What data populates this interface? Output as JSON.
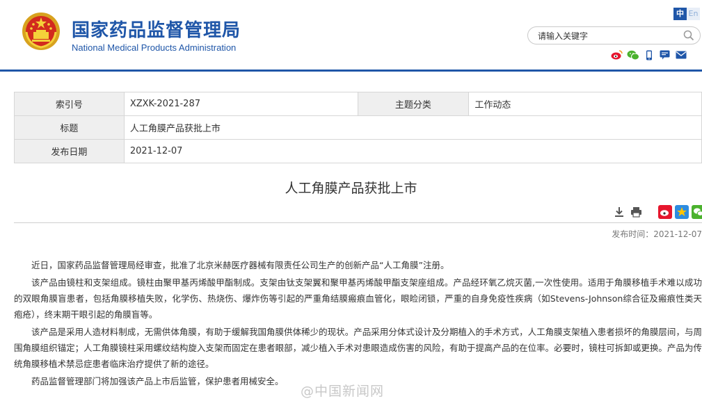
{
  "header": {
    "title_cn": "国家药品监督管理局",
    "title_en": "National Medical Products Administration",
    "lang_cn": "中",
    "lang_en": "En",
    "search_placeholder": "请输入关键字",
    "share_icons": [
      "weibo-icon",
      "wechat-icon",
      "mobile-icon",
      "message-icon",
      "email-icon"
    ]
  },
  "info": {
    "index_label": "索引号",
    "index_value": "XZXK-2021-287",
    "category_label": "主题分类",
    "category_value": "工作动态",
    "title_label": "标题",
    "title_value": "人工角膜产品获批上市",
    "date_label": "发布日期",
    "date_value": "2021-12-07"
  },
  "article": {
    "title": "人工角膜产品获批上市",
    "pubdate": "发布时间：2021-12-07",
    "paragraphs": [
      "近日，国家药品监督管理局经审查，批准了北京米赫医疗器械有限责任公司生产的创新产品“人工角膜”注册。",
      "该产品由镜柱和支架组成。镜柱由聚甲基丙烯酸甲酯制成。支架由钛支架翼和聚甲基丙烯酸甲酯支架座组成。产品经环氧乙烷灭菌,一次性使用。适用于角膜移植手术难以成功的双眼角膜盲患者，包括角膜移植失败，化学伤、热烧伤、爆炸伤等引起的严重角结膜瘢痕血管化，眼睑闭锁，严重的自身免疫性疾病（如Stevens-Johnson综合征及瘢痕性类天疱疮），终末期干眼引起的角膜盲等。",
      "该产品是采用人造材料制成，无需供体角膜，有助于缓解我国角膜供体稀少的现状。产品采用分体式设计及分期植入的手术方式，人工角膜支架植入患者损坏的角膜层间，与周围角膜组织锚定；人工角膜镜柱采用螺纹结构旋入支架而固定在患者眼部，减少植入手术对患眼造成伤害的风险，有助于提高产品的在位率。必要时，镜柱可拆卸或更换。产品为传统角膜移植术禁忌症患者临床治疗提供了新的途径。",
      "药品监督管理部门将加强该产品上市后监管，保护患者用械安全。"
    ]
  },
  "watermark": "@中国新闻网",
  "colors": {
    "brand_blue": "#1f56a8",
    "label_bg": "#efefef"
  }
}
